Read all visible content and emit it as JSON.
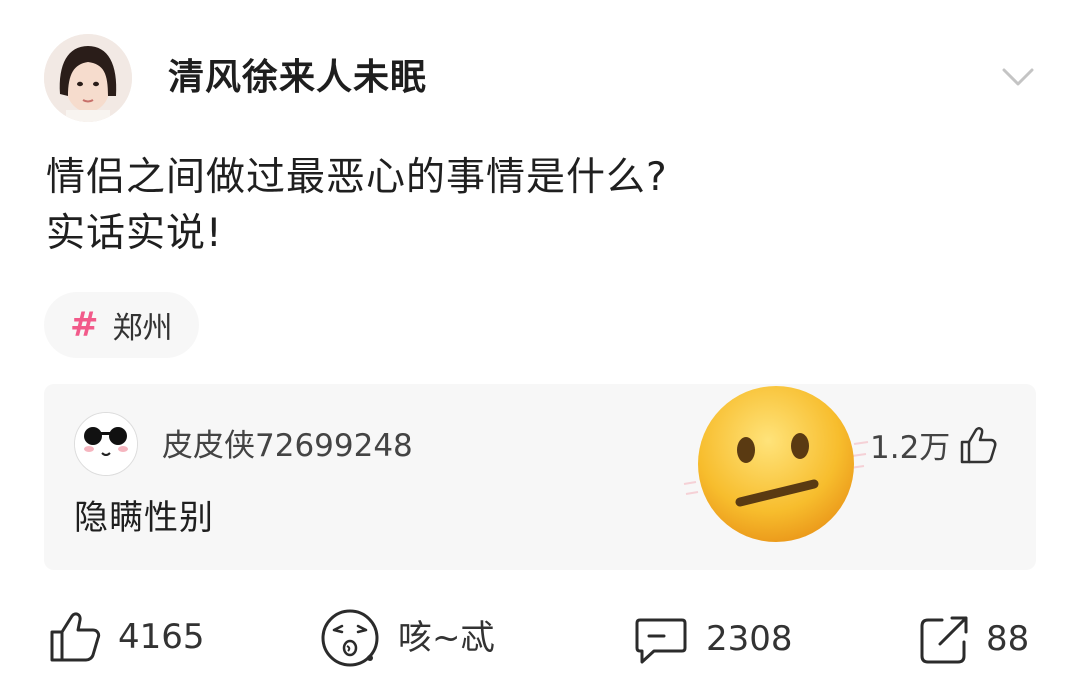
{
  "post": {
    "author": "清风徐来人未眠",
    "text_lines": [
      "情侣之间做过最恶心的事情是什么?",
      "实话实说!"
    ],
    "tag": {
      "icon": "hash-icon",
      "label": "郑州",
      "color": "#f25a8a"
    }
  },
  "comment": {
    "author": "皮皮侠72699248",
    "text": "隐瞒性别",
    "likes": "1.2万",
    "reaction_emoji": "neutral-face-emoji"
  },
  "actions": {
    "like_count": "4165",
    "reaction_label": "咳~忒",
    "comment_count": "2308",
    "share_count": "88"
  }
}
